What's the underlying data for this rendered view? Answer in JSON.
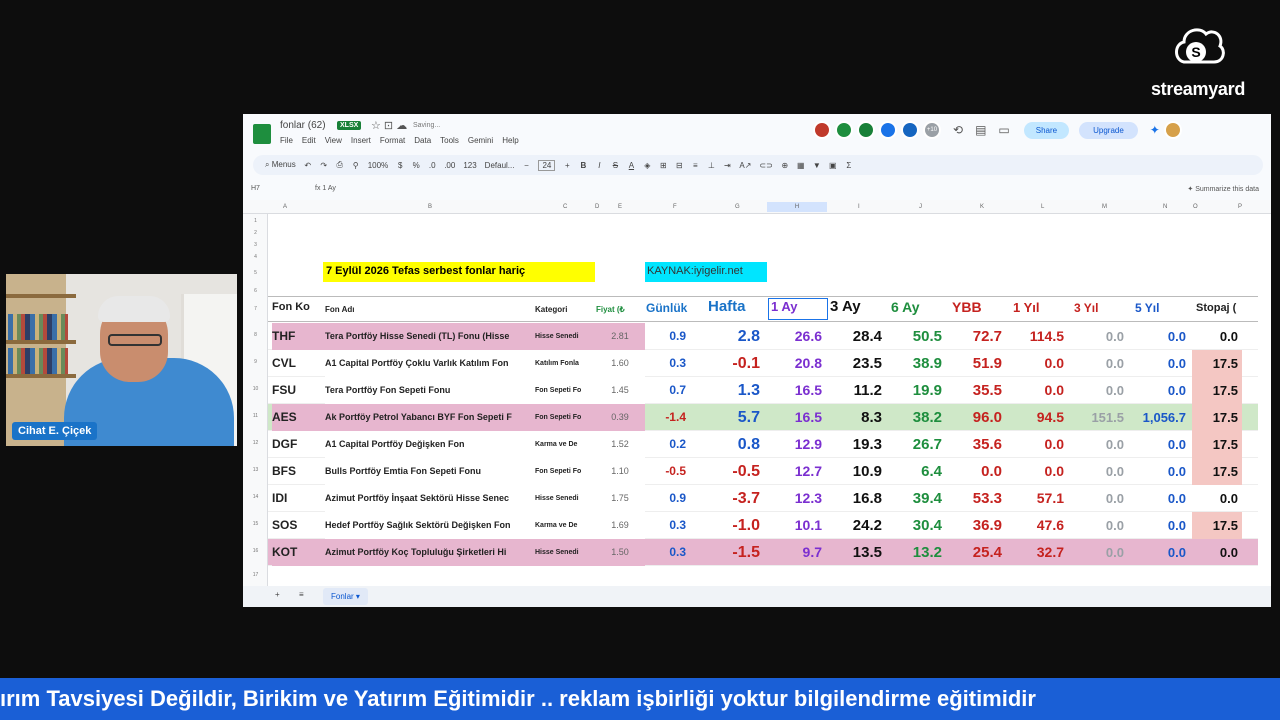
{
  "brand": {
    "name": "streamyard"
  },
  "webcam": {
    "name": "Cihat E. Çiçek"
  },
  "doc": {
    "title": "fonlar (62)",
    "badge": "XLSX",
    "saving": "Saving...",
    "menus": [
      "File",
      "Edit",
      "View",
      "Insert",
      "Format",
      "Data",
      "Tools",
      "Gemini",
      "Help"
    ],
    "collab_count": "+10",
    "share": "Share",
    "upgrade": "Upgrade"
  },
  "toolbar": {
    "search": "Menus",
    "zoom": "100%",
    "font": "Defaul...",
    "size": "24",
    "percent": "%",
    "dec": ".0",
    "dec2": ".00",
    "num": "123"
  },
  "formula": {
    "ref": "H7",
    "fx": "1 Ay",
    "summarize": "Summarize this data"
  },
  "columns": [
    "A",
    "B",
    "C",
    "D",
    "E",
    "F",
    "G",
    "H",
    "I",
    "J",
    "K",
    "L",
    "M",
    "N",
    "O",
    "P"
  ],
  "rows": [
    "1",
    "2",
    "3",
    "4",
    "5",
    "6",
    "7",
    "8",
    "9",
    "10",
    "11",
    "12",
    "13",
    "14",
    "15",
    "16",
    "17"
  ],
  "sheet_title": "7 Eylül 2026 Tefas serbest fonlar hariç",
  "source": "KAYNAK:iyigelir.net",
  "headers": {
    "code": "Fon Ko",
    "name": "Fon Adı",
    "cat": "Kategori",
    "price": "Fiyat (₺",
    "daily": "Günlük",
    "week": "Hafta",
    "m1": "1 Ay",
    "m3": "3 Ay",
    "m6": "6 Ay",
    "ybb": "YBB",
    "y1": "1 Yıl",
    "y3": "3 Yıl",
    "y5": "5 Yıl",
    "tax": "Stopaj ("
  },
  "funds": [
    {
      "code": "THF",
      "name": "Tera Portföy Hisse Senedi (TL) Fonu (Hisse",
      "cat": "Hisse Senedi",
      "price": "2.81",
      "daily": "0.9",
      "week": "2.8",
      "m1": "26.6",
      "m3": "28.4",
      "m6": "50.5",
      "ybb": "72.7",
      "y1": "114.5",
      "y3": "0.0",
      "y5": "0.0",
      "tax": "0.0"
    },
    {
      "code": "CVL",
      "name": "A1 Capital Portföy Çoklu Varlık Katılım Fon",
      "cat": "Katılım Fonla",
      "price": "1.60",
      "daily": "0.3",
      "week": "-0.1",
      "m1": "20.8",
      "m3": "23.5",
      "m6": "38.9",
      "ybb": "51.9",
      "y1": "0.0",
      "y3": "0.0",
      "y5": "0.0",
      "tax": "17.5"
    },
    {
      "code": "FSU",
      "name": "Tera Portföy Fon Sepeti Fonu",
      "cat": "Fon Sepeti Fo",
      "price": "1.45",
      "daily": "0.7",
      "week": "1.3",
      "m1": "16.5",
      "m3": "11.2",
      "m6": "19.9",
      "ybb": "35.5",
      "y1": "0.0",
      "y3": "0.0",
      "y5": "0.0",
      "tax": "17.5"
    },
    {
      "code": "AES",
      "name": "Ak Portföy Petrol Yabancı BYF Fon Sepeti F",
      "cat": "Fon Sepeti Fo",
      "price": "0.39",
      "daily": "-1.4",
      "week": "5.7",
      "m1": "16.5",
      "m3": "8.3",
      "m6": "38.2",
      "ybb": "96.0",
      "y1": "94.5",
      "y3": "151.5",
      "y5": "1,056.7",
      "tax": "17.5"
    },
    {
      "code": "DGF",
      "name": "A1 Capital Portföy Değişken Fon",
      "cat": "Karma ve De",
      "price": "1.52",
      "daily": "0.2",
      "week": "0.8",
      "m1": "12.9",
      "m3": "19.3",
      "m6": "26.7",
      "ybb": "35.6",
      "y1": "0.0",
      "y3": "0.0",
      "y5": "0.0",
      "tax": "17.5"
    },
    {
      "code": "BFS",
      "name": "Bulls Portföy Emtia Fon Sepeti Fonu",
      "cat": "Fon Sepeti Fo",
      "price": "1.10",
      "daily": "-0.5",
      "week": "-0.5",
      "m1": "12.7",
      "m3": "10.9",
      "m6": "6.4",
      "ybb": "0.0",
      "y1": "0.0",
      "y3": "0.0",
      "y5": "0.0",
      "tax": "17.5"
    },
    {
      "code": "IDI",
      "name": "Azimut Portföy İnşaat Sektörü Hisse Senec",
      "cat": "Hisse Senedi",
      "price": "1.75",
      "daily": "0.9",
      "week": "-3.7",
      "m1": "12.3",
      "m3": "16.8",
      "m6": "39.4",
      "ybb": "53.3",
      "y1": "57.1",
      "y3": "0.0",
      "y5": "0.0",
      "tax": "0.0"
    },
    {
      "code": "SOS",
      "name": "Hedef Portföy Sağlık Sektörü Değişken Fon",
      "cat": "Karma ve De",
      "price": "1.69",
      "daily": "0.3",
      "week": "-1.0",
      "m1": "10.1",
      "m3": "24.2",
      "m6": "30.4",
      "ybb": "36.9",
      "y1": "47.6",
      "y3": "0.0",
      "y5": "0.0",
      "tax": "17.5"
    },
    {
      "code": "KOT",
      "name": "Azimut Portföy Koç Topluluğu Şirketleri Hi",
      "cat": "Hisse Senedi",
      "price": "1.50",
      "daily": "0.3",
      "week": "-1.5",
      "m1": "9.7",
      "m3": "13.5",
      "m6": "13.2",
      "ybb": "25.4",
      "y1": "32.7",
      "y3": "0.0",
      "y5": "0.0",
      "tax": "0.0"
    }
  ],
  "sheet_tab": "Fonlar",
  "ticker": "ırım Tavsiyesi Değildir, Birikim ve Yatırım Eğitimidir .. reklam işbirliği yoktur bilgilendirme eğitimidir",
  "colors": {
    "ticker_bg": "#1a5fd6",
    "highlight_pink": "#e7b6cf",
    "highlight_green": "#cfe8c8",
    "title_yellow": "#ffff00",
    "source_cyan": "#00e5ff"
  }
}
